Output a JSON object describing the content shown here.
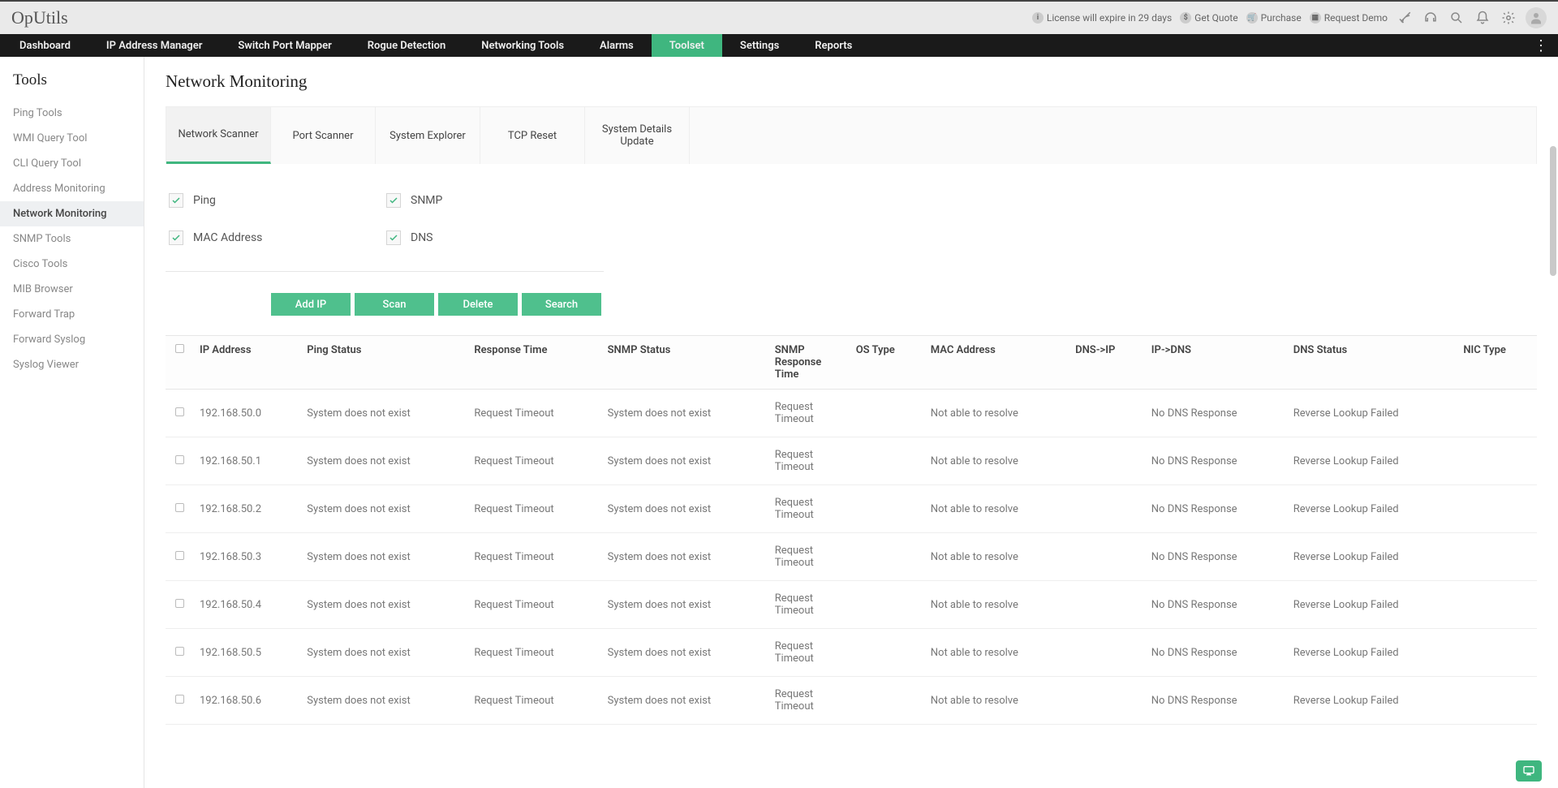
{
  "brand": "OpUtils",
  "top_links": {
    "license": "License will expire in 29 days",
    "quote": "Get Quote",
    "purchase": "Purchase",
    "demo": "Request Demo"
  },
  "nav": [
    {
      "label": "Dashboard",
      "active": false
    },
    {
      "label": "IP Address Manager",
      "active": false
    },
    {
      "label": "Switch Port Mapper",
      "active": false
    },
    {
      "label": "Rogue Detection",
      "active": false
    },
    {
      "label": "Networking Tools",
      "active": false
    },
    {
      "label": "Alarms",
      "active": false
    },
    {
      "label": "Toolset",
      "active": true
    },
    {
      "label": "Settings",
      "active": false
    },
    {
      "label": "Reports",
      "active": false
    }
  ],
  "sidebar": {
    "title": "Tools",
    "items": [
      {
        "label": "Ping Tools",
        "active": false
      },
      {
        "label": "WMI Query Tool",
        "active": false
      },
      {
        "label": "CLI Query Tool",
        "active": false
      },
      {
        "label": "Address Monitoring",
        "active": false
      },
      {
        "label": "Network Monitoring",
        "active": true
      },
      {
        "label": "SNMP Tools",
        "active": false
      },
      {
        "label": "Cisco Tools",
        "active": false
      },
      {
        "label": "MIB Browser",
        "active": false
      },
      {
        "label": "Forward Trap",
        "active": false
      },
      {
        "label": "Forward Syslog",
        "active": false
      },
      {
        "label": "Syslog Viewer",
        "active": false
      }
    ]
  },
  "page": {
    "title": "Network Monitoring",
    "tabs": [
      {
        "label": "Network Scanner",
        "active": true
      },
      {
        "label": "Port Scanner",
        "active": false
      },
      {
        "label": "System Explorer",
        "active": false
      },
      {
        "label": "TCP Reset",
        "active": false
      },
      {
        "label": "System Details Update",
        "active": false
      }
    ],
    "checks": {
      "ping": "Ping",
      "snmp": "SNMP",
      "mac": "MAC Address",
      "dns": "DNS"
    },
    "buttons": {
      "add": "Add IP",
      "scan": "Scan",
      "delete": "Delete",
      "search": "Search"
    },
    "headers": {
      "ip": "IP Address",
      "ping": "Ping Status",
      "resp": "Response Time",
      "snmp": "SNMP Status",
      "snmp_resp": "SNMP Response Time",
      "os": "OS Type",
      "mac": "MAC Address",
      "dns_ip": "DNS->IP",
      "ip_dns": "IP->DNS",
      "dns_status": "DNS Status",
      "nic": "NIC Type"
    },
    "rows": [
      {
        "ip": "192.168.50.0",
        "ping": "System does not exist",
        "resp": "Request Timeout",
        "snmp": "System does not exist",
        "snmp_resp": "Request Timeout",
        "os": "",
        "mac": "Not able to resolve",
        "dns_ip": "",
        "ip_dns": "No DNS Response",
        "dns_status": "Reverse Lookup Failed",
        "nic": ""
      },
      {
        "ip": "192.168.50.1",
        "ping": "System does not exist",
        "resp": "Request Timeout",
        "snmp": "System does not exist",
        "snmp_resp": "Request Timeout",
        "os": "",
        "mac": "Not able to resolve",
        "dns_ip": "",
        "ip_dns": "No DNS Response",
        "dns_status": "Reverse Lookup Failed",
        "nic": ""
      },
      {
        "ip": "192.168.50.2",
        "ping": "System does not exist",
        "resp": "Request Timeout",
        "snmp": "System does not exist",
        "snmp_resp": "Request Timeout",
        "os": "",
        "mac": "Not able to resolve",
        "dns_ip": "",
        "ip_dns": "No DNS Response",
        "dns_status": "Reverse Lookup Failed",
        "nic": ""
      },
      {
        "ip": "192.168.50.3",
        "ping": "System does not exist",
        "resp": "Request Timeout",
        "snmp": "System does not exist",
        "snmp_resp": "Request Timeout",
        "os": "",
        "mac": "Not able to resolve",
        "dns_ip": "",
        "ip_dns": "No DNS Response",
        "dns_status": "Reverse Lookup Failed",
        "nic": ""
      },
      {
        "ip": "192.168.50.4",
        "ping": "System does not exist",
        "resp": "Request Timeout",
        "snmp": "System does not exist",
        "snmp_resp": "Request Timeout",
        "os": "",
        "mac": "Not able to resolve",
        "dns_ip": "",
        "ip_dns": "No DNS Response",
        "dns_status": "Reverse Lookup Failed",
        "nic": ""
      },
      {
        "ip": "192.168.50.5",
        "ping": "System does not exist",
        "resp": "Request Timeout",
        "snmp": "System does not exist",
        "snmp_resp": "Request Timeout",
        "os": "",
        "mac": "Not able to resolve",
        "dns_ip": "",
        "ip_dns": "No DNS Response",
        "dns_status": "Reverse Lookup Failed",
        "nic": ""
      },
      {
        "ip": "192.168.50.6",
        "ping": "System does not exist",
        "resp": "Request Timeout",
        "snmp": "System does not exist",
        "snmp_resp": "Request Timeout",
        "os": "",
        "mac": "Not able to resolve",
        "dns_ip": "",
        "ip_dns": "No DNS Response",
        "dns_status": "Reverse Lookup Failed",
        "nic": ""
      }
    ]
  }
}
